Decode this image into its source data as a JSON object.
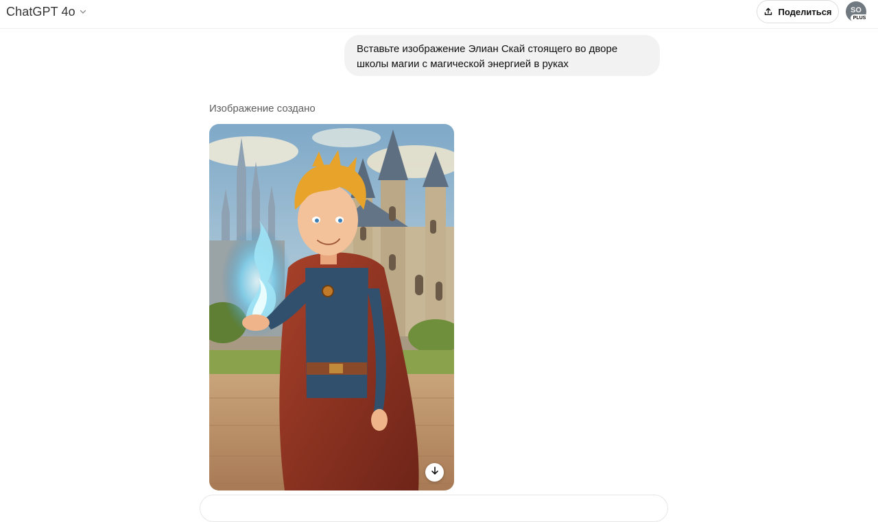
{
  "header": {
    "model_name": "ChatGPT 4o",
    "share_label": "Поделиться",
    "avatar_initials": "SO",
    "plan_badge": "PLUS"
  },
  "conversation": {
    "user_message": "Вставьте изображение Элиан Скай стоящего во дворе школы магии с магической энергией в руках",
    "assistant_status": "Изображение создано"
  },
  "icons": {
    "model_dropdown": "chevron-down-icon",
    "share": "upload-icon",
    "download": "arrow-down-icon"
  },
  "colors": {
    "bubble_bg": "#f2f2f2",
    "avatar_bg": "#707880",
    "status_text": "#5d5d5d"
  }
}
